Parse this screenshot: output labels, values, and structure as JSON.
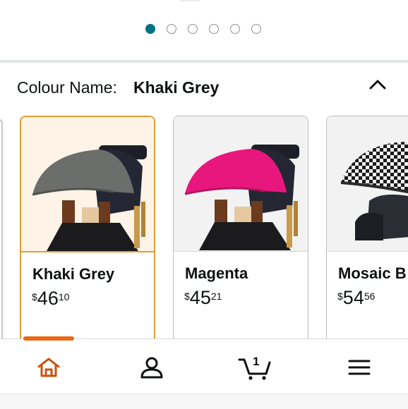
{
  "carousel": {
    "page_count": 6,
    "active_index": 0
  },
  "colour": {
    "label": "Colour Name:",
    "selected": "Khaki Grey"
  },
  "swatches": [
    {
      "name": "Khaki Grey",
      "price": {
        "symbol": "$",
        "whole": "46",
        "fraction": "10"
      },
      "canopy_color": "#6b6e6a",
      "selected": true
    },
    {
      "name": "Magenta",
      "price": {
        "symbol": "$",
        "whole": "45",
        "fraction": "21"
      },
      "canopy_color": "#e8177d",
      "selected": false
    },
    {
      "name": "Mosaic B",
      "price": {
        "symbol": "$",
        "whole": "54",
        "fraction": "56"
      },
      "canopy_color": "#e6e6e6",
      "selected": false
    }
  ],
  "nav": {
    "items": [
      "home-icon",
      "account-icon",
      "cart-icon",
      "menu-icon"
    ],
    "cart_count": "1",
    "active": "home",
    "accent": "#e96a1b"
  }
}
